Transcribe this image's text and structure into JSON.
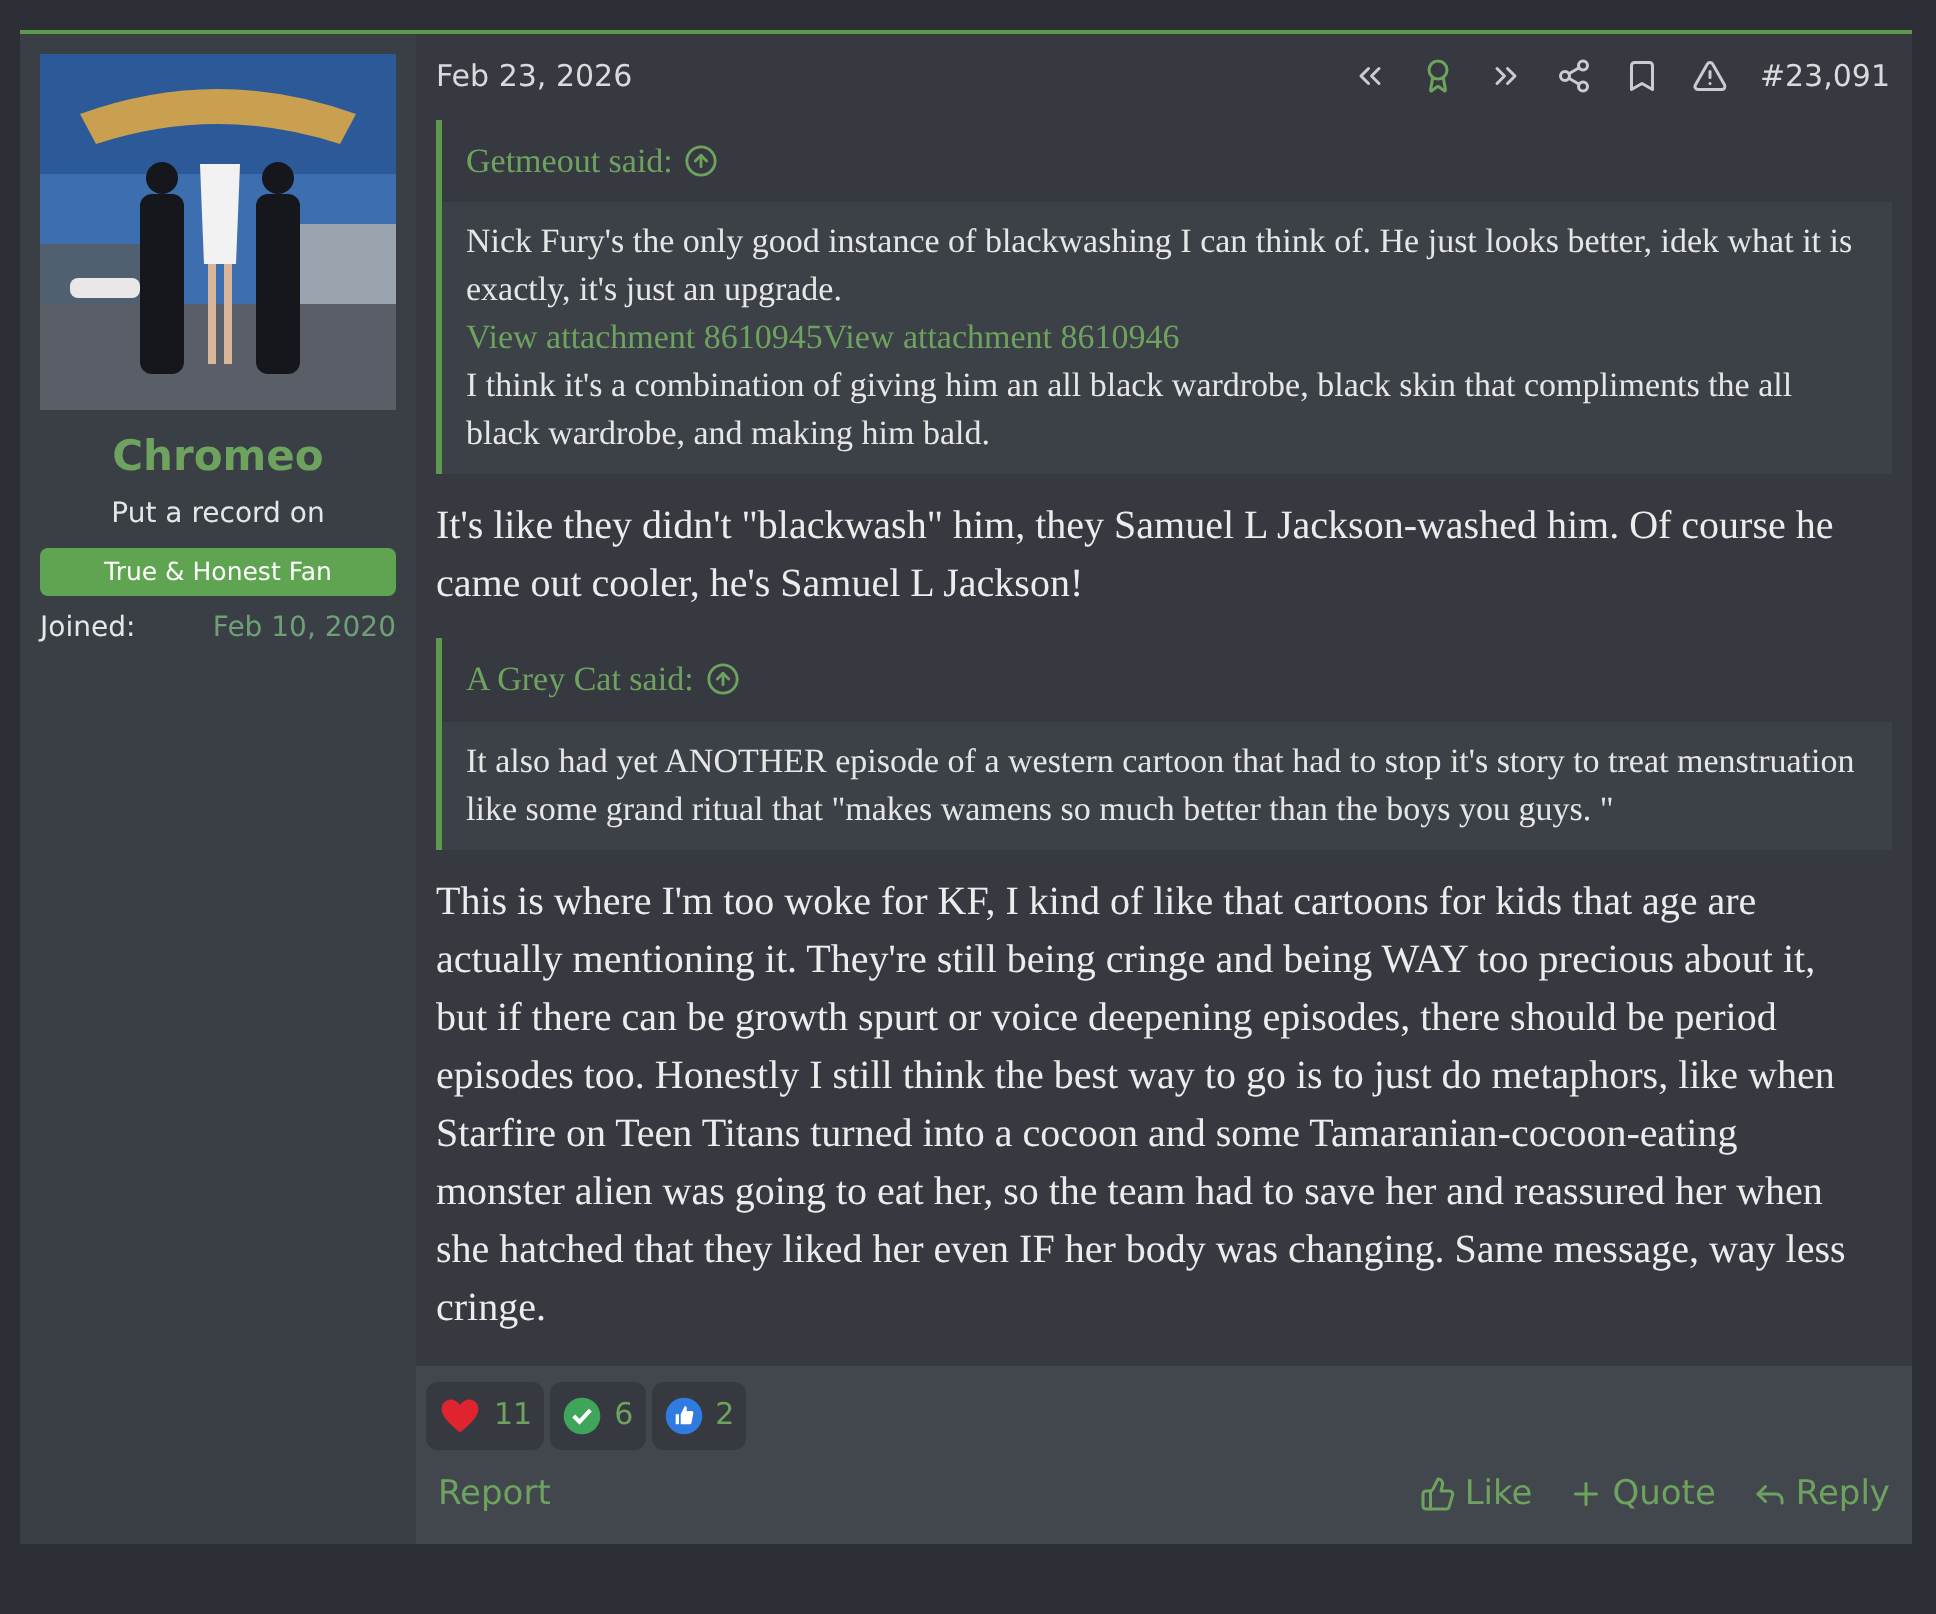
{
  "user": {
    "name": "Chromeo",
    "title": "Put a record on",
    "banner": "True & Honest Fan",
    "joined_label": "Joined:",
    "joined_value": "Feb 10, 2020"
  },
  "post": {
    "date": "Feb 23, 2026",
    "number": "#23,091",
    "actions": [
      {
        "kind": "first"
      },
      {
        "kind": "award"
      },
      {
        "kind": "last"
      },
      {
        "kind": "share"
      },
      {
        "kind": "bookmark"
      },
      {
        "kind": "report"
      }
    ],
    "content": [
      {
        "kind": "quote",
        "author": "Getmeout said:",
        "lines": [
          {
            "kind": "text",
            "text": "Nick Fury's the only good instance of blackwashing I can think of. He just looks better, idek what it is exactly, it's just an upgrade."
          },
          {
            "kind": "links",
            "links": [
              "View attachment 8610945",
              "View attachment 8610946"
            ]
          },
          {
            "kind": "text",
            "text": "I think it's a combination of giving him an all black wardrobe, black skin that compliments the all black wardrobe, and making him bald."
          }
        ]
      },
      {
        "kind": "paragraph",
        "text": "It's like they didn't \"blackwash\" him, they Samuel L Jackson-washed him. Of course he came out cooler, he's Samuel L Jackson!"
      },
      {
        "kind": "quote",
        "author": "A Grey Cat said:",
        "lines": [
          {
            "kind": "text",
            "text": "It also had yet ANOTHER episode of a western cartoon that had to stop it's story to treat menstruation like some grand ritual that \"makes wamens so much better than the boys you guys. \""
          }
        ]
      },
      {
        "kind": "paragraph",
        "text": "This is where I'm too woke for KF, I kind of like that cartoons for kids that age are actually mentioning it. They're still being cringe and being WAY too precious about it, but if there can be growth spurt or voice deepening episodes, there should be period episodes too. Honestly I still think the best way to go is to just do metaphors, like when Starfire on Teen Titans turned into a cocoon and some Tamaranian-cocoon-eating monster alien was going to eat her, so the team had to save her and reassured her when she hatched that they liked her even IF her body was changing. Same message, way less cringe."
      }
    ],
    "reactions": [
      {
        "kind": "heart",
        "count": "11"
      },
      {
        "kind": "check",
        "count": "6"
      },
      {
        "kind": "thumb",
        "count": "2"
      }
    ],
    "report": "Report",
    "buttons": [
      {
        "kind": "like",
        "label": "Like"
      },
      {
        "kind": "quote",
        "label": "Quote"
      },
      {
        "kind": "reply",
        "label": "Reply"
      }
    ]
  }
}
